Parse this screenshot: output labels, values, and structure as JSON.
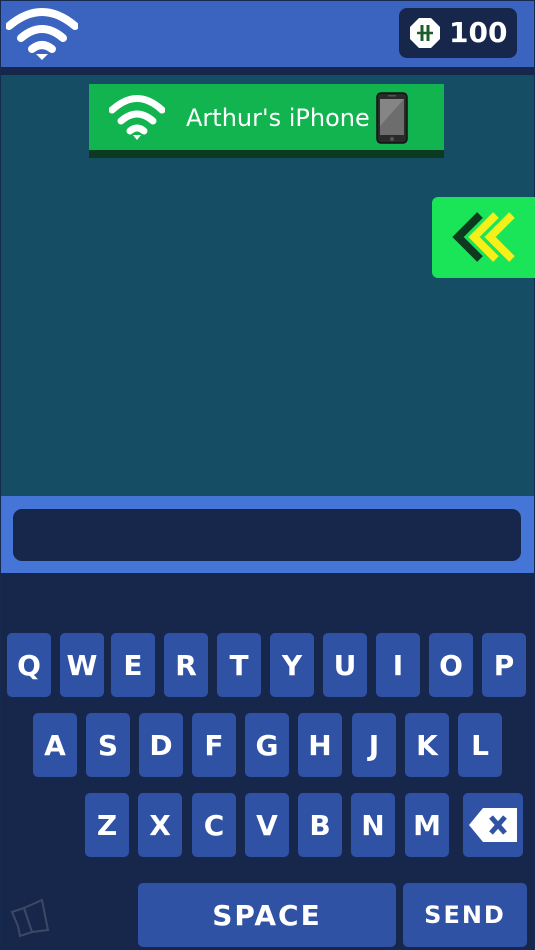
{
  "header": {
    "wifi_icon": "wifi-icon",
    "coin_icon": "coin-icon",
    "coin_amount": "100"
  },
  "network": {
    "icon": "wifi-icon",
    "name": "Arthur's iPhone",
    "device_icon": "phone-icon"
  },
  "back_button": {
    "icon": "double-chevron-left-icon"
  },
  "input": {
    "value": "",
    "placeholder": ""
  },
  "keyboard": {
    "row1": [
      "Q",
      "W",
      "E",
      "R",
      "T",
      "Y",
      "U",
      "I",
      "O",
      "P"
    ],
    "row2": [
      "A",
      "S",
      "D",
      "F",
      "G",
      "H",
      "J",
      "K",
      "L"
    ],
    "row3": [
      "Z",
      "X",
      "C",
      "V",
      "B",
      "N",
      "M"
    ],
    "backspace_icon": "backspace-icon",
    "space_label": "SPACE",
    "send_label": "SEND",
    "speaker_icon": "speaker-icon"
  },
  "colors": {
    "top_bar": "#3a64c0",
    "game_area": "#154d65",
    "banner_green": "#12b44f",
    "back_button_green": "#1ae457",
    "key": "#3052a5",
    "dark_navy": "#17264b",
    "input_strip": "#4575d7"
  }
}
